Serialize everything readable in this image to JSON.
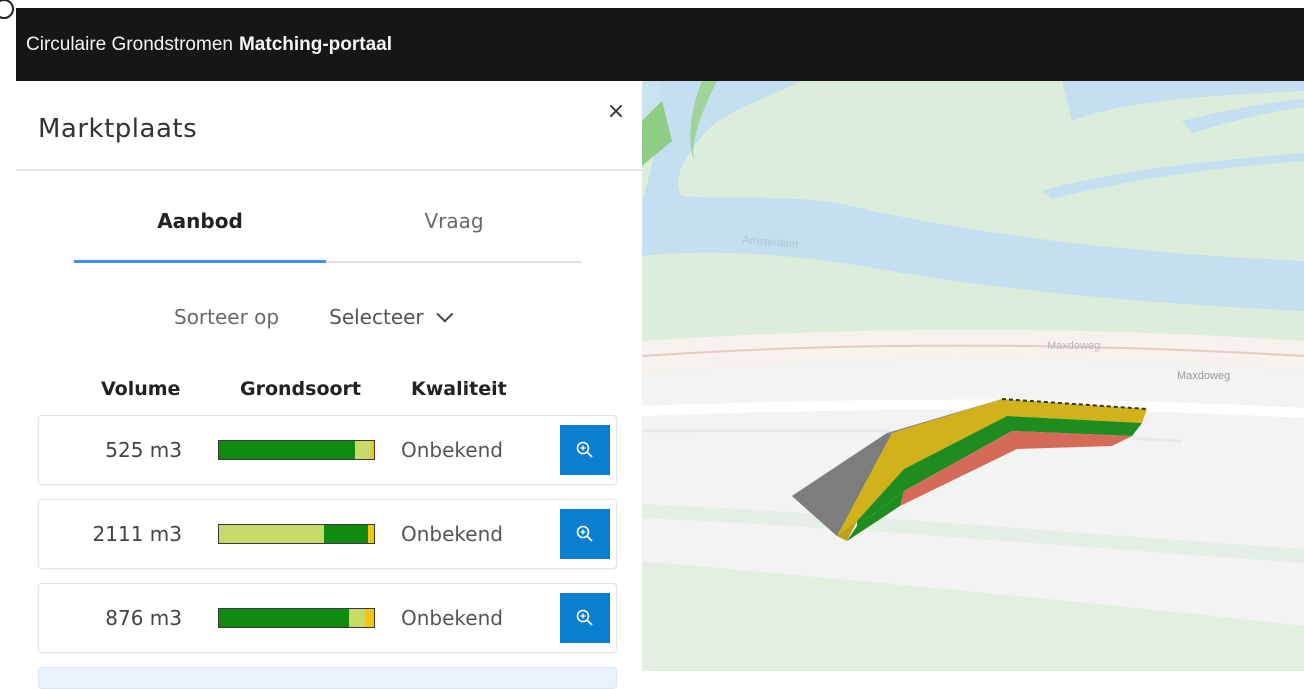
{
  "app": {
    "brand": "Circulaire Grondstromen",
    "brand_strong": "Matching-portaal"
  },
  "panel": {
    "title": "Marktplaats",
    "close_label": "×",
    "tabs": [
      {
        "label": "Aanbod",
        "active": true
      },
      {
        "label": "Vraag",
        "active": false
      }
    ],
    "sort": {
      "label": "Sorteer op",
      "value": "Selecteer"
    },
    "columns": {
      "volume": "Volume",
      "soil": "Grondsoort",
      "quality": "Kwaliteit"
    },
    "listings": [
      {
        "volume": "525 m3",
        "quality": "Onbekend",
        "soil_composition": [
          {
            "color": "#0f8b0f",
            "fraction": 0.88
          },
          {
            "color": "#c8d96a",
            "fraction": 0.1
          },
          {
            "color": "#f5c40c",
            "fraction": 0.02
          }
        ]
      },
      {
        "volume": "2111 m3",
        "quality": "Onbekend",
        "soil_composition": [
          {
            "color": "#c8d96a",
            "fraction": 0.68
          },
          {
            "color": "#0f8b0f",
            "fraction": 0.28
          },
          {
            "color": "#f5c40c",
            "fraction": 0.04
          }
        ]
      },
      {
        "volume": "876 m3",
        "quality": "Onbekend",
        "soil_composition": [
          {
            "color": "#0f8b0f",
            "fraction": 0.84
          },
          {
            "color": "#c8d96a",
            "fraction": 0.1
          },
          {
            "color": "#f5c40c",
            "fraction": 0.06
          }
        ]
      }
    ],
    "zoom_icon": "zoom-in-icon",
    "accent_color": "#4589ff",
    "button_color": "#0b7fcf"
  },
  "map": {
    "road_labels": [
      "Maxdoweg",
      "Maxdoweg"
    ],
    "water_label": "Amsterdam",
    "soil_layer_colors": [
      "#777777",
      "#e3c21a",
      "#0f8b0f",
      "#d0604a"
    ]
  }
}
